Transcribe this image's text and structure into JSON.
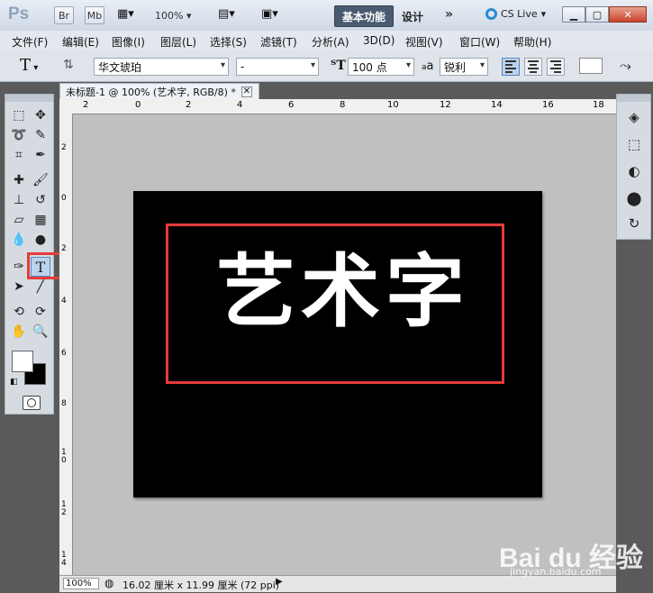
{
  "app": {
    "logo_text": "Ps",
    "title_buttons": [
      "Br",
      "Mb"
    ],
    "zoom_level": "100%",
    "workspace_active": "基本功能",
    "workspace_other": "设计",
    "workspace_more": "»",
    "cs_live": "CS Live"
  },
  "menu": [
    "文件(F)",
    "编辑(E)",
    "图像(I)",
    "图层(L)",
    "选择(S)",
    "滤镜(T)",
    "分析(A)",
    "3D(D)",
    "视图(V)",
    "窗口(W)",
    "帮助(H)"
  ],
  "options": {
    "tool_glyph": "T",
    "font_family": "华文琥珀",
    "font_style": "-",
    "font_size": "100 点",
    "aa_label": "a",
    "antialias": "锐利"
  },
  "document": {
    "tab_title": "未标题-1 @ 100% (艺术字, RGB/8) *",
    "canvas_text": "艺术字",
    "ruler_top": [
      "2",
      "0",
      "2",
      "4",
      "6",
      "8",
      "10",
      "12",
      "14",
      "16",
      "18"
    ],
    "ruler_left": [
      "2",
      "0",
      "2",
      "4",
      "6",
      "8",
      "10",
      "12",
      "14"
    ]
  },
  "status": {
    "zoom": "100%",
    "doc_info": "16.02 厘米 x 11.99 厘米 (72 ppi)"
  },
  "watermark": {
    "main": "Bai du 经验",
    "sub": "jingyan.baidu.com"
  },
  "colors": {
    "highlight": "#e53b3b",
    "canvas_bg": "#000000",
    "canvas_text": "#ffffff"
  }
}
